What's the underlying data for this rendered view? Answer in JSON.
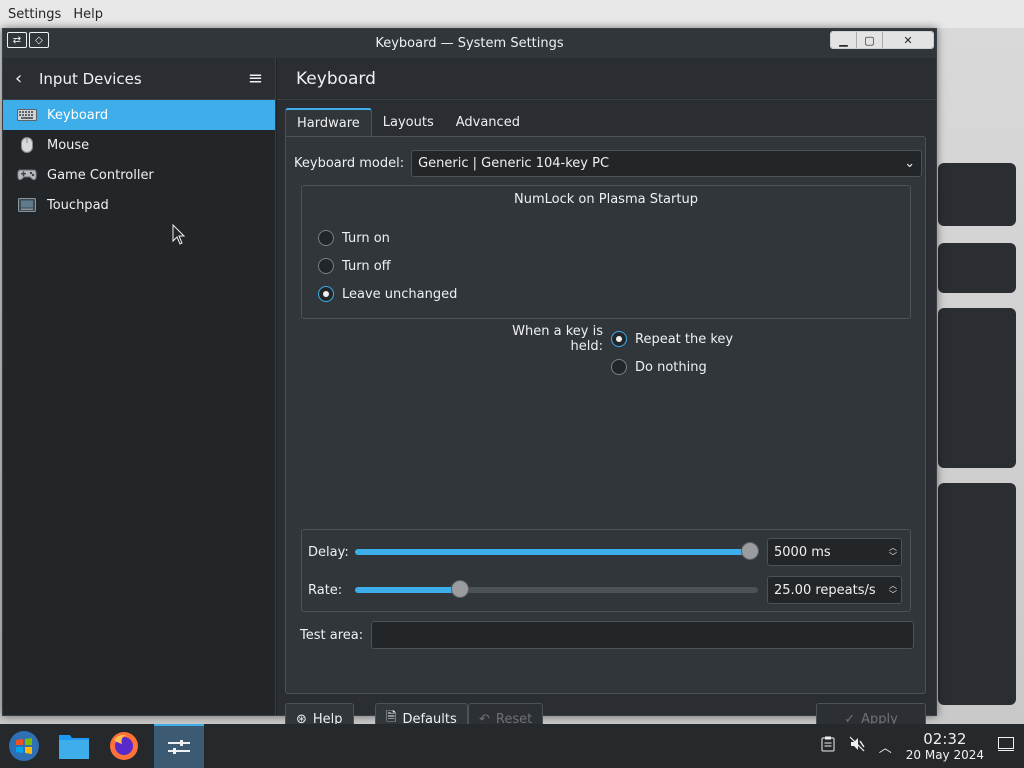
{
  "global_menu": {
    "items": [
      "Settings",
      "Help"
    ]
  },
  "window": {
    "title": "Keyboard — System Settings"
  },
  "sidebar": {
    "header_title": "Input Devices",
    "items": [
      {
        "label": "Keyboard",
        "icon": "keyboard-icon",
        "active": true
      },
      {
        "label": "Mouse",
        "icon": "mouse-icon",
        "active": false
      },
      {
        "label": "Game Controller",
        "icon": "gamepad-icon",
        "active": false
      },
      {
        "label": "Touchpad",
        "icon": "touchpad-icon",
        "active": false
      }
    ]
  },
  "main": {
    "page_title": "Keyboard",
    "tabs": [
      {
        "label": "Hardware",
        "active": true
      },
      {
        "label": "Layouts",
        "active": false
      },
      {
        "label": "Advanced",
        "active": false
      }
    ],
    "keyboard_model": {
      "label": "Keyboard model:",
      "value": "Generic | Generic 104-key PC"
    },
    "numlock": {
      "title": "NumLock on Plasma Startup",
      "options": [
        {
          "label": "Turn on",
          "checked": false
        },
        {
          "label": "Turn off",
          "checked": false
        },
        {
          "label": "Leave unchanged",
          "checked": true
        }
      ]
    },
    "key_held": {
      "label": "When a key is held:",
      "options": [
        {
          "label": "Repeat the key",
          "checked": true
        },
        {
          "label": "Do nothing",
          "checked": false
        }
      ]
    },
    "delay": {
      "label": "Delay:",
      "value": "5000 ms",
      "fraction": 0.98
    },
    "rate": {
      "label": "Rate:",
      "value": "25.00 repeats/s",
      "fraction": 0.26
    },
    "test_area": {
      "label": "Test area:",
      "value": ""
    }
  },
  "footer": {
    "help_label": "Help",
    "defaults_label": "Defaults",
    "reset_label": "Reset",
    "apply_label": "Apply"
  },
  "taskbar": {
    "time": "02:32",
    "date": "20 May 2024"
  },
  "colors": {
    "accent": "#3daee9",
    "window_bg": "#2a2e32",
    "panel_bg": "#31363b"
  }
}
